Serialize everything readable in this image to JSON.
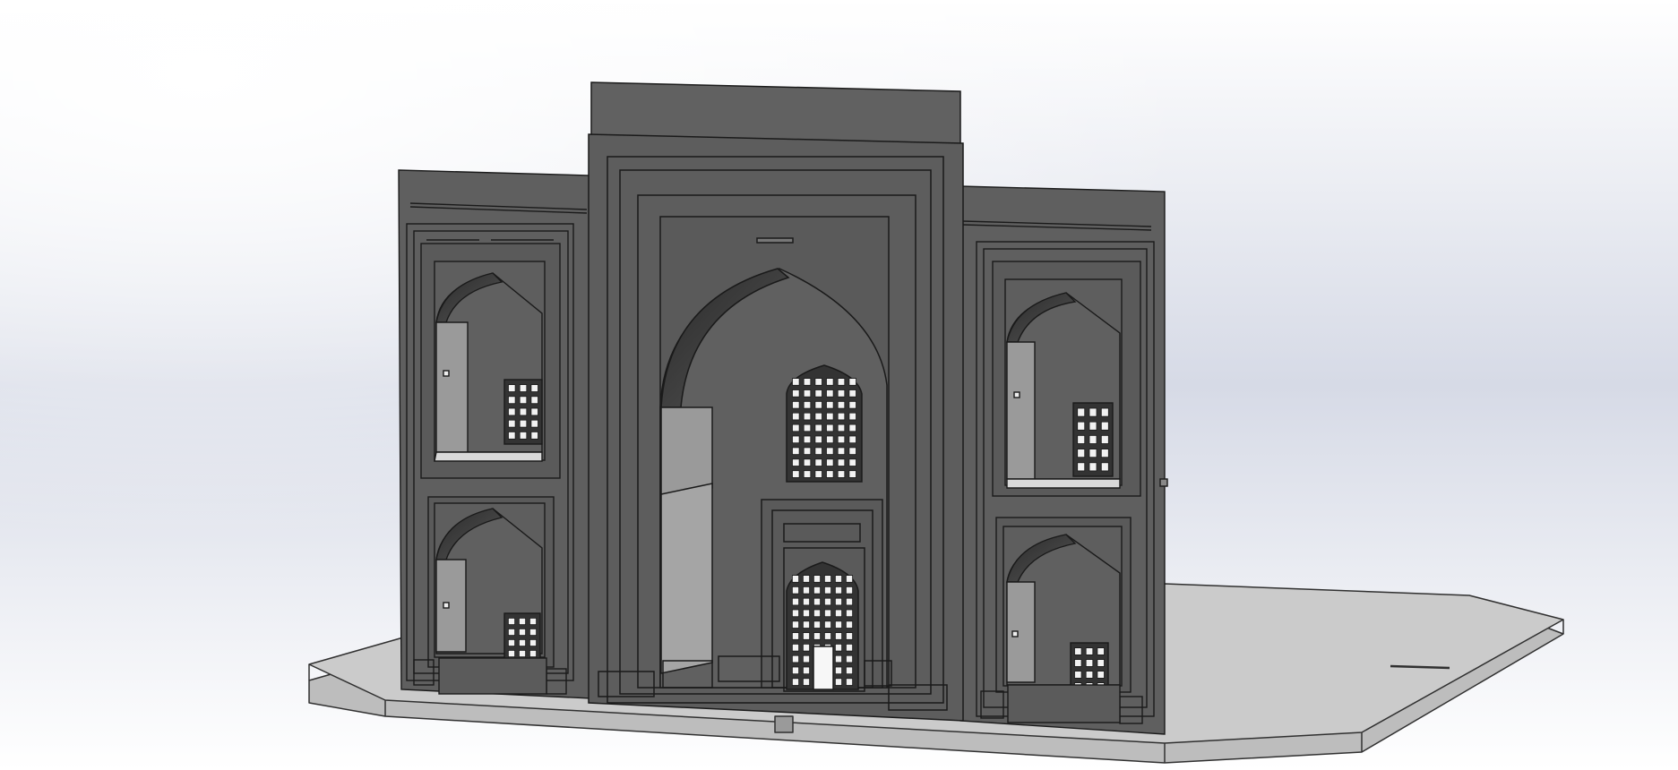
{
  "viewport": {
    "background": {
      "top": "#ffffff",
      "band": "#d6dae6",
      "bottom": "#ffffff"
    },
    "model": {
      "subject": "madrasa-portal-facade",
      "shading": "shaded-with-edges",
      "colors": {
        "wall": "#606060",
        "wall_edge": "#1a1a1a",
        "niche_side": "#9a9a9a",
        "niche_floor": "#d9d9d9",
        "base_plate": "#c8c8c8",
        "base_plate_edge": "#303030",
        "window_pane": "#f2f2f2",
        "door": "#f7f7f7"
      }
    }
  }
}
